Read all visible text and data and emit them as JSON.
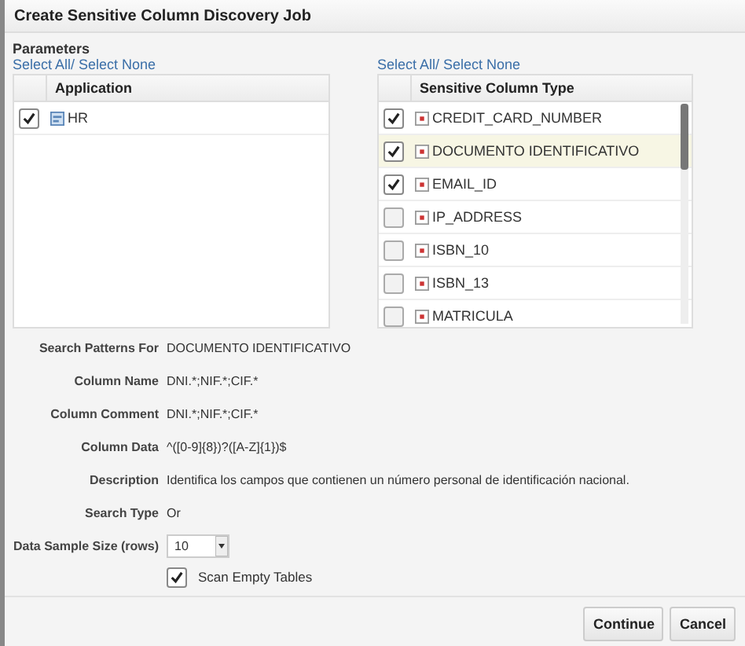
{
  "window": {
    "title": "Create Sensitive Column Discovery Job"
  },
  "parameters": {
    "heading": "Parameters",
    "applications": {
      "select_link": "Select All/ Select None",
      "column": "Application",
      "rows": [
        {
          "name": "HR",
          "checked": true,
          "selected": false
        }
      ]
    },
    "column_types": {
      "select_link": "Select All/ Select None",
      "column": "Sensitive Column Type",
      "rows": [
        {
          "name": "CREDIT_CARD_NUMBER",
          "checked": true,
          "selected": false
        },
        {
          "name": "DOCUMENTO IDENTIFICATIVO",
          "checked": true,
          "selected": true
        },
        {
          "name": "EMAIL_ID",
          "checked": true,
          "selected": false
        },
        {
          "name": "IP_ADDRESS",
          "checked": false,
          "selected": false
        },
        {
          "name": "ISBN_10",
          "checked": false,
          "selected": false
        },
        {
          "name": "ISBN_13",
          "checked": false,
          "selected": false
        },
        {
          "name": "MATRICULA",
          "checked": false,
          "selected": false
        }
      ]
    }
  },
  "details": [
    {
      "label": "Search Patterns For",
      "value": "DOCUMENTO IDENTIFICATIVO",
      "kind": "text"
    },
    {
      "label": "Column Name",
      "value": "DNI.*;NIF.*;CIF.*",
      "kind": "text"
    },
    {
      "label": "Column Comment",
      "value": "DNI.*;NIF.*;CIF.*",
      "kind": "text"
    },
    {
      "label": "Column Data",
      "value": "^([0-9]{8})?([A-Z]{1})$",
      "kind": "text"
    },
    {
      "label": "Description",
      "value": "Identifica los campos que contienen un número personal de identificación nacional.",
      "kind": "text"
    },
    {
      "label": "Search Type",
      "value": "Or",
      "kind": "text"
    },
    {
      "label": "Data Sample Size (rows)",
      "value": "10",
      "kind": "select"
    }
  ],
  "scan_empty_tables": {
    "label": "Scan Empty Tables",
    "checked": true
  },
  "buttons": [
    "Continue",
    "Cancel"
  ]
}
